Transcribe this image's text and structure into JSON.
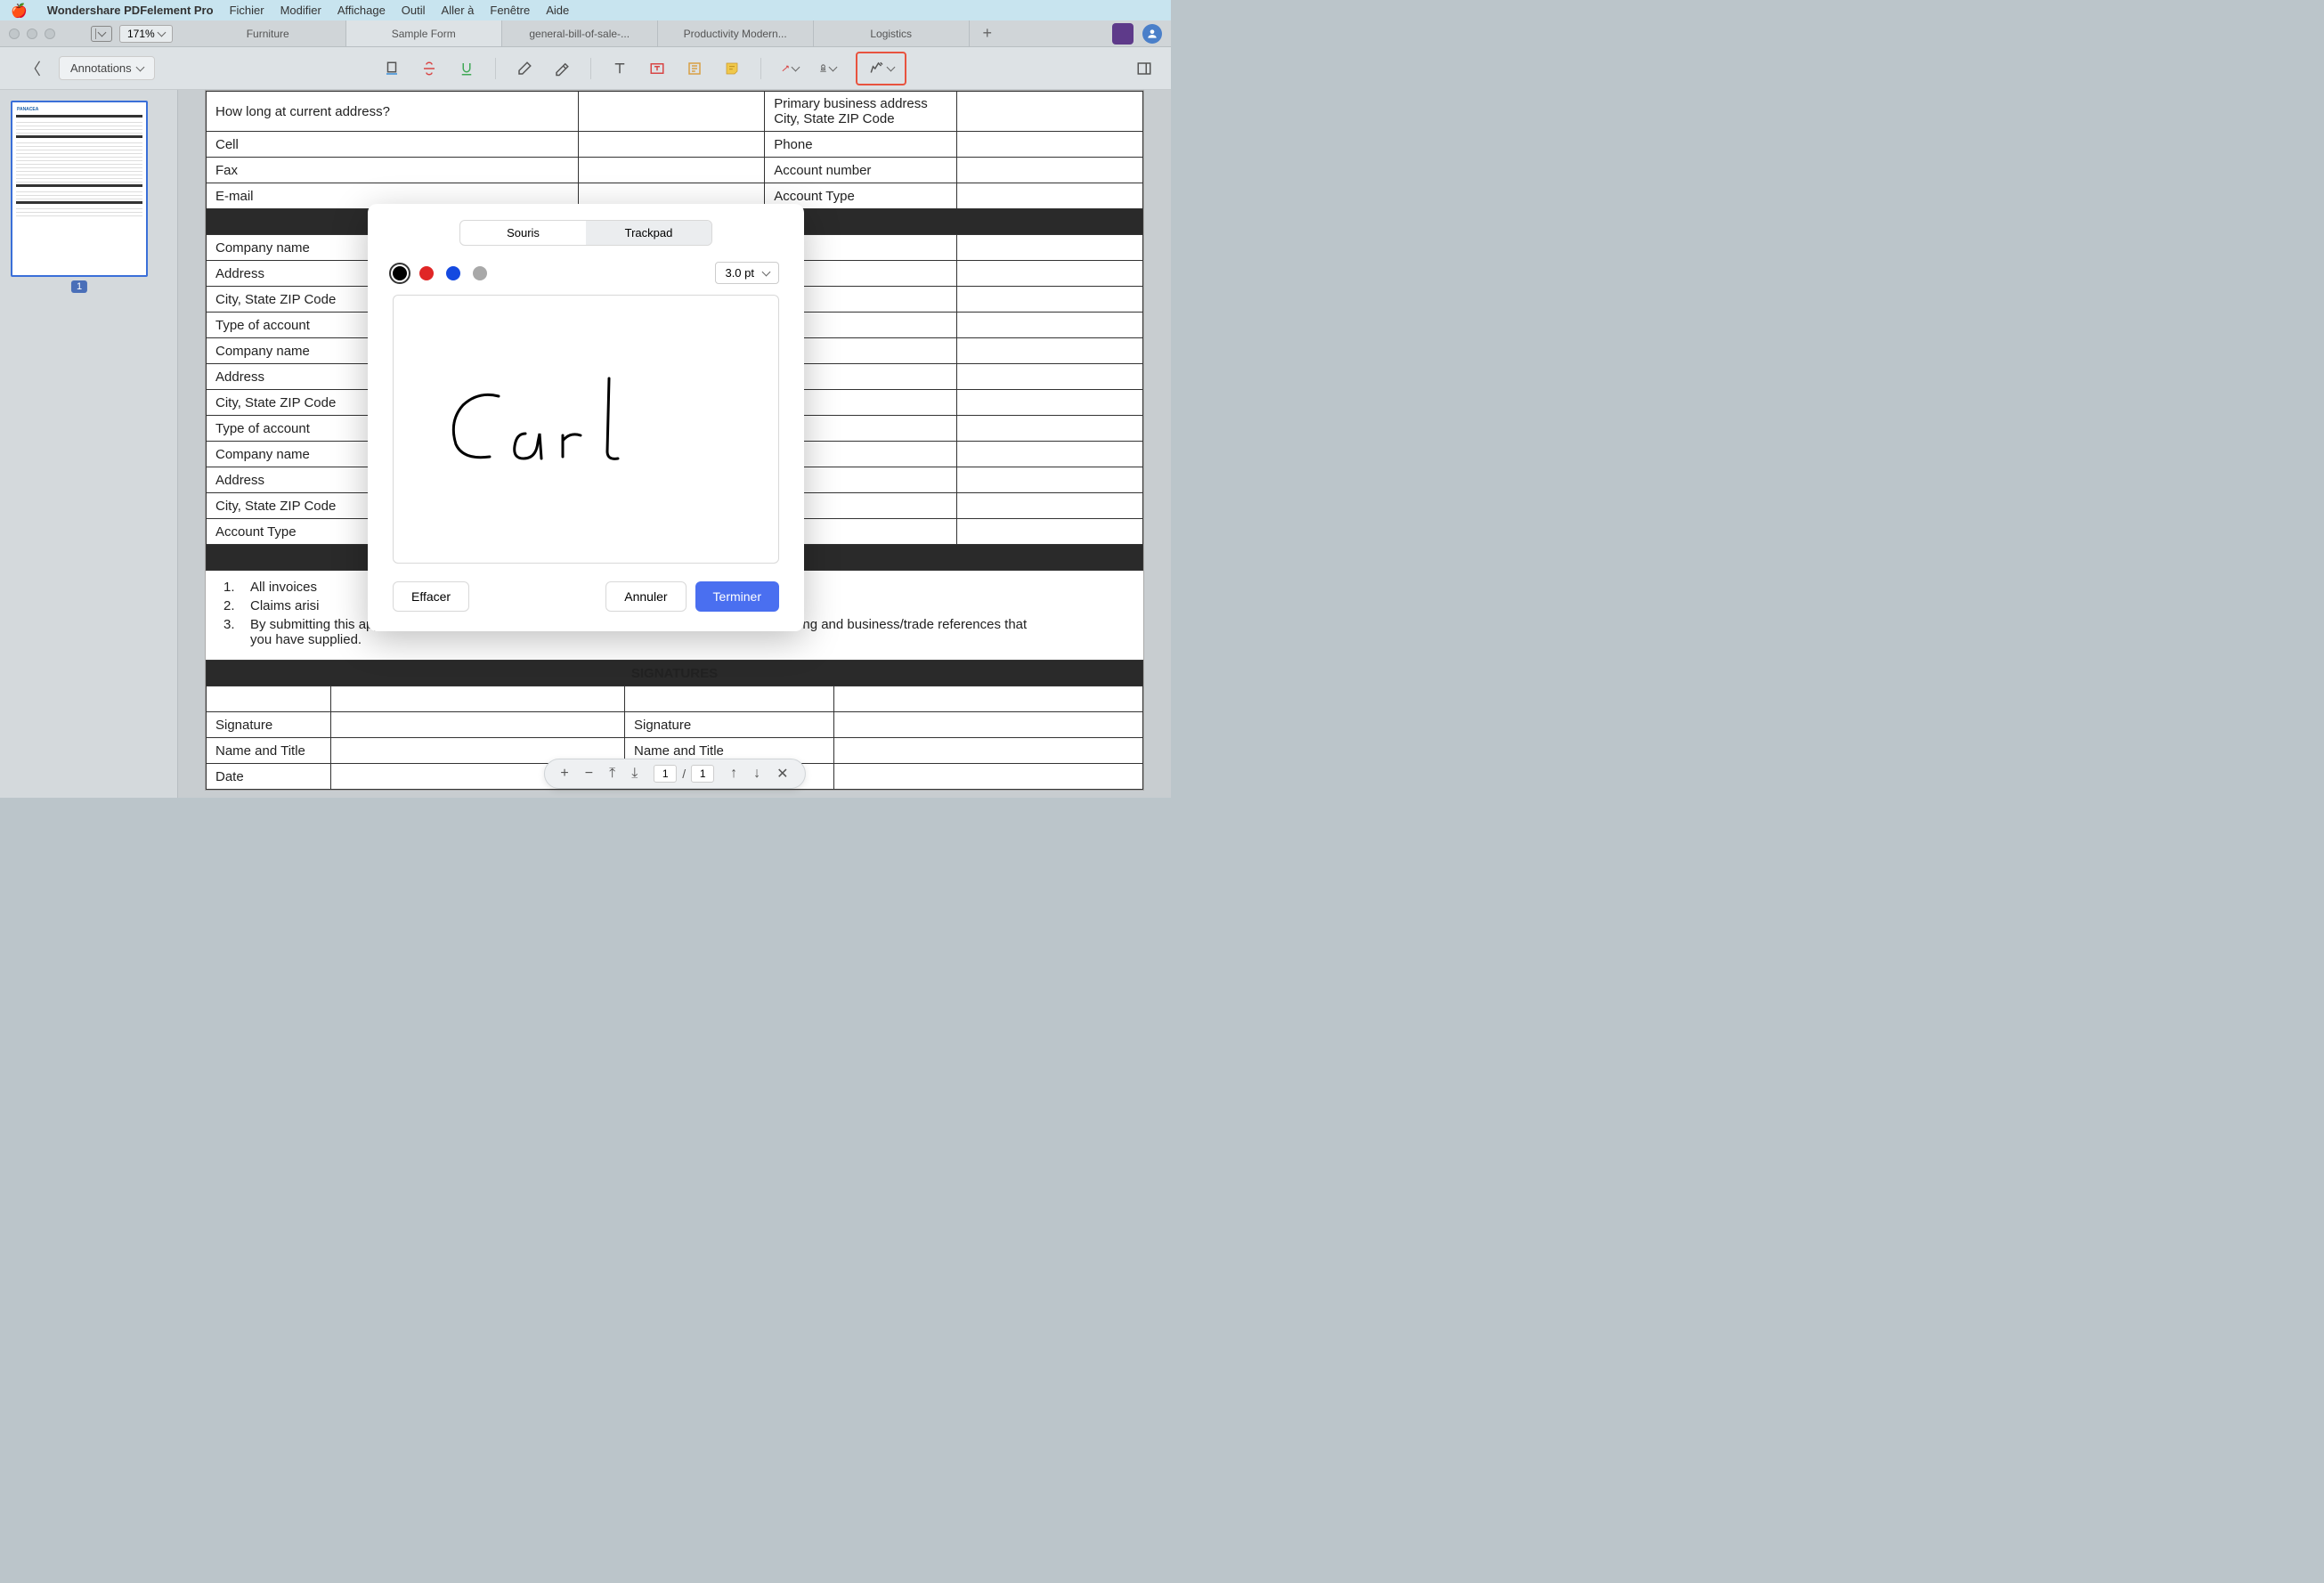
{
  "menubar": {
    "app_name": "Wondershare PDFelement Pro",
    "items": [
      "Fichier",
      "Modifier",
      "Affichage",
      "Outil",
      "Aller à",
      "Fenêtre",
      "Aide"
    ]
  },
  "window": {
    "zoom": "171%",
    "tabs": [
      "Furniture",
      "Sample Form",
      "general-bill-of-sale-...",
      "Productivity Modern...",
      "Logistics"
    ]
  },
  "toolbar": {
    "annotations_label": "Annotations"
  },
  "thumbnail": {
    "title": "PANACEA",
    "page_num": "1"
  },
  "form": {
    "rows_top_left": [
      "How long at current address?",
      "Cell",
      "Fax",
      "E-mail"
    ],
    "rows_top_right": [
      "Primary business address City, State ZIP Code",
      "Phone",
      "Account number",
      "Account Type"
    ],
    "bank_rows": [
      "Company name",
      "Address",
      "City, State ZIP Code",
      "Type of account",
      "Company name",
      "Address",
      "City, State ZIP Code",
      "Type of account",
      "Company name",
      "Address",
      "City, State ZIP Code",
      "Account Type"
    ],
    "terms": [
      "All invoices",
      "Claims arisi",
      "By submitting this application, you authorize Alpha Resources to make inquiries into the banking and business/trade references that you have supplied."
    ],
    "sig_header": "SIGNATURES",
    "sig_rows": [
      "Signature",
      "Name and Title",
      "Date"
    ]
  },
  "dialog": {
    "tab_mouse": "Souris",
    "tab_trackpad": "Trackpad",
    "colors": [
      "#000000",
      "#e02626",
      "#1449e0",
      "#a8a8a8"
    ],
    "thickness": "3.0 pt",
    "signature_text": "Carl",
    "btn_clear": "Effacer",
    "btn_cancel": "Annuler",
    "btn_done": "Terminer"
  },
  "pagenav": {
    "current": "1",
    "total": "1"
  }
}
